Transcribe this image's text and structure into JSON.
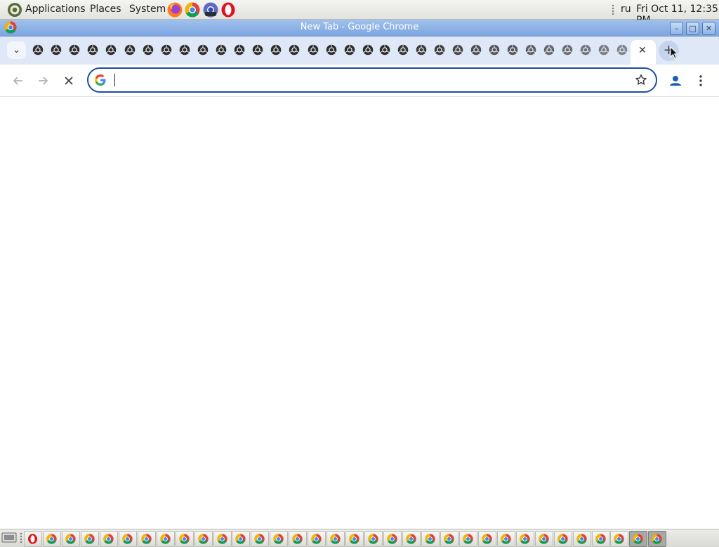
{
  "top_panel": {
    "menus": [
      "Applications",
      "Places",
      "System"
    ],
    "keyboard_layout": "ru",
    "clock": "Fri Oct 11, 12:35 PM",
    "launchers": [
      "firefox-icon",
      "chrome-icon",
      "chrome-dev-icon",
      "edge-dev-icon",
      "opera-icon"
    ]
  },
  "window": {
    "title": "New Tab - Google Chrome"
  },
  "tabstrip": {
    "tab_search_icon": "chevron-down-icon",
    "background_tab_count": 33,
    "active_tab_close_icon": "close-icon",
    "new_tab_icon": "plus-icon"
  },
  "toolbar": {
    "omnibox": {
      "value": "",
      "placeholder": ""
    },
    "icons": [
      "back-arrow-icon",
      "forward-arrow-icon",
      "stop-loading-icon",
      "google-g-icon",
      "bookmark-star-icon",
      "profile-icon",
      "more-vert-icon"
    ]
  },
  "taskbar": {
    "window_button_count": 34,
    "icons": [
      "show-desktop-icon",
      "opera-icon",
      "chrome-icon"
    ]
  },
  "colors": {
    "tabstrip_bg": "#dfe8f7",
    "omnibox_border": "#1a4fa6",
    "titlebar_bg": "#8fb4e6",
    "panel_bg": "#e8e8e5"
  }
}
